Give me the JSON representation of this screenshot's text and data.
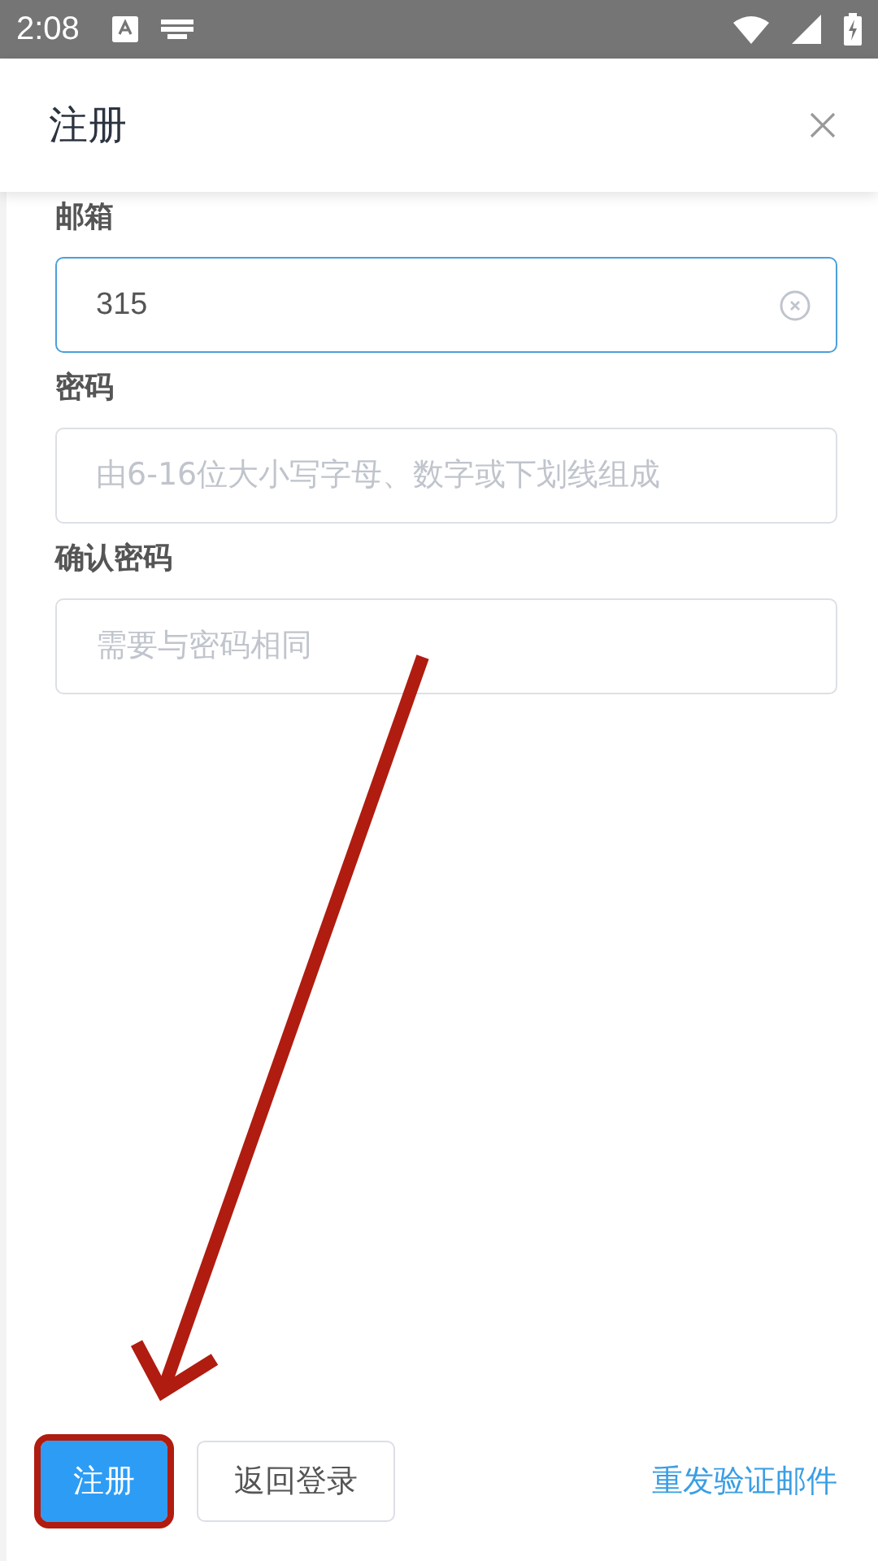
{
  "status_bar": {
    "time": "2:08"
  },
  "dialog": {
    "title": "注册"
  },
  "fields": [
    {
      "label": "邮箱",
      "value": "315",
      "focused": true,
      "clearable": true
    },
    {
      "label": "密码",
      "placeholder": "由6-16位大小写字母、数字或下划线组成",
      "focused": false,
      "clearable": false
    },
    {
      "label": "确认密码",
      "placeholder": "需要与密码相同",
      "focused": false,
      "clearable": false
    }
  ],
  "buttons": [
    {
      "kind": "primary",
      "label": "注册",
      "highlighted": true
    },
    {
      "kind": "plain",
      "label": "返回登录",
      "highlighted": false
    },
    {
      "kind": "link",
      "label": "重发验证邮件",
      "highlighted": false
    }
  ]
}
